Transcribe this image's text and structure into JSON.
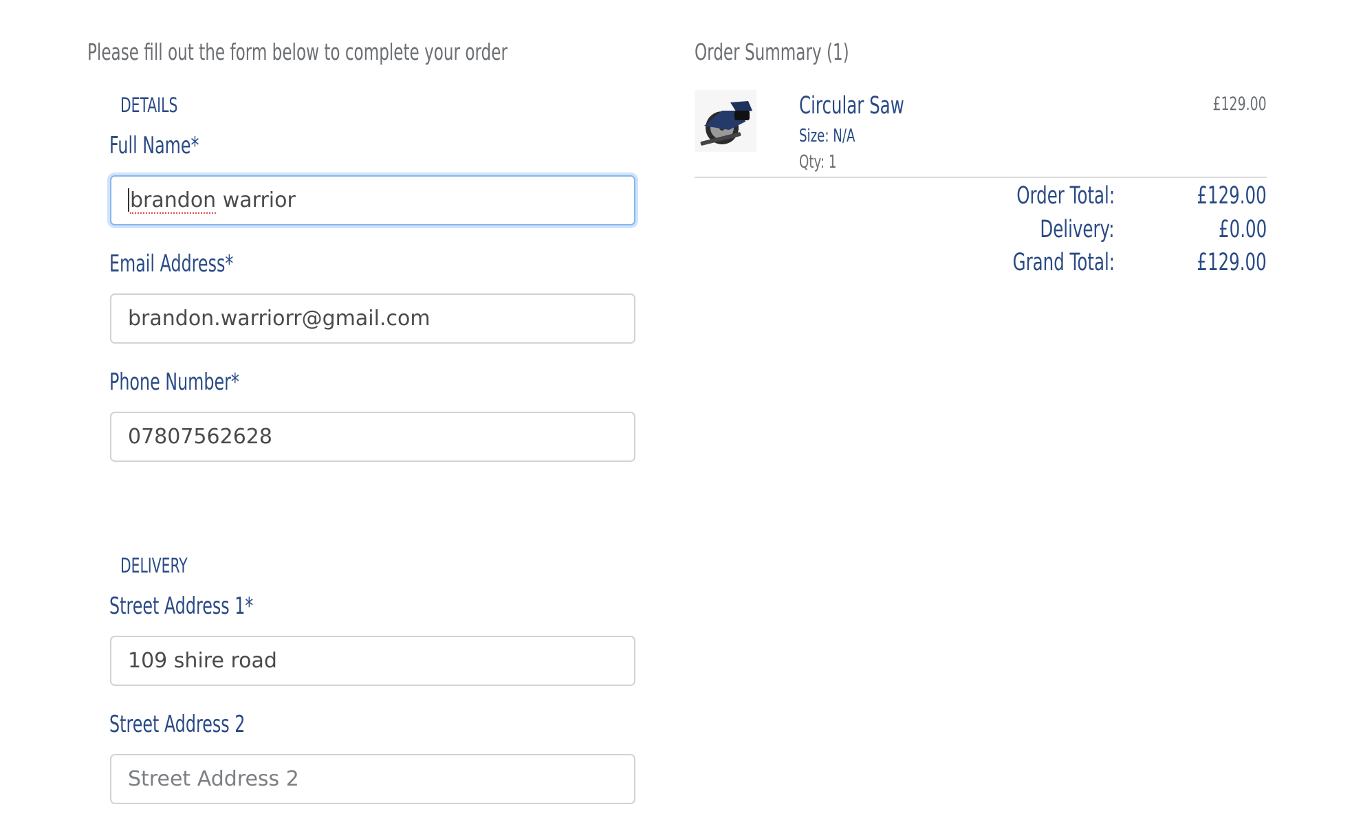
{
  "form": {
    "intro": "Please fill out the form below to complete your order",
    "details_section": "DETAILS",
    "full_name": {
      "label": "Full Name*",
      "value": "brandon warrior",
      "value_first": "brandon",
      "value_rest": " warrior"
    },
    "email": {
      "label": "Email Address*",
      "value": "brandon.warriorr@gmail.com"
    },
    "phone": {
      "label": "Phone Number*",
      "value": "07807562628"
    },
    "delivery_section": "DELIVERY",
    "street1": {
      "label": "Street Address 1*",
      "value": "109 shire road"
    },
    "street2": {
      "label": "Street Address 2",
      "value": "",
      "placeholder": "Street Address 2"
    }
  },
  "summary": {
    "title": "Order Summary (1)",
    "item": {
      "image_icon": "circular-saw-image",
      "name": "Circular Saw",
      "size": "Size: N/A",
      "qty": "Qty: 1",
      "price": "£129.00"
    },
    "totals": {
      "order_total_label": "Order Total:",
      "order_total_value": "£129.00",
      "delivery_label": "Delivery:",
      "delivery_value": "£0.00",
      "grand_total_label": "Grand Total:",
      "grand_total_value": "£129.00"
    }
  },
  "colors": {
    "brand_blue": "#2a4a86",
    "muted_text": "#6b6e72",
    "focus_ring": "#86b7ee"
  }
}
